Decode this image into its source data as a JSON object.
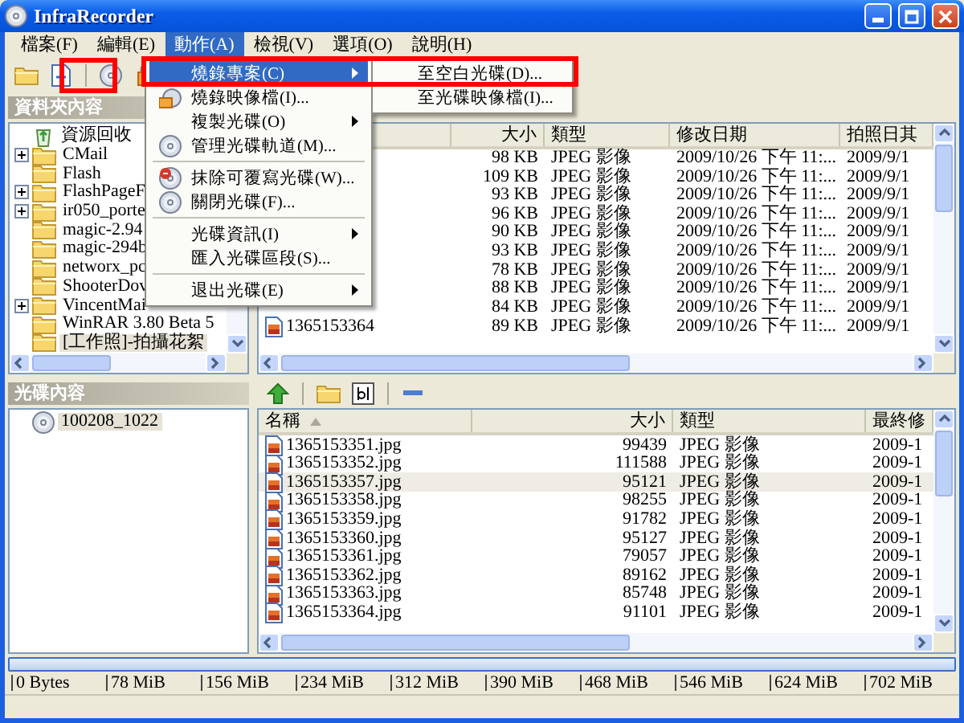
{
  "window": {
    "title": "InfraRecorder"
  },
  "menu_bar": [
    {
      "label": "檔案(F)",
      "selected": false
    },
    {
      "label": "編輯(E)",
      "selected": false
    },
    {
      "label": "動作(A)",
      "selected": true
    },
    {
      "label": "檢視(V)",
      "selected": false
    },
    {
      "label": "選項(O)",
      "selected": false
    },
    {
      "label": "說明(H)",
      "selected": false
    }
  ],
  "actions_menu": {
    "items": [
      {
        "kind": "item",
        "label": "燒錄專案(C)",
        "submenu": true,
        "selected": true
      },
      {
        "kind": "item",
        "label": "燒錄映像檔(I)...",
        "submenu": false,
        "selected": false
      },
      {
        "kind": "item",
        "label": "複製光碟(O)",
        "submenu": true,
        "selected": false
      },
      {
        "kind": "item",
        "label": "管理光碟軌道(M)...",
        "submenu": false,
        "selected": false
      },
      {
        "kind": "separator"
      },
      {
        "kind": "item",
        "label": "抹除可覆寫光碟(W)...",
        "submenu": false,
        "selected": false
      },
      {
        "kind": "item",
        "label": "關閉光碟(F)...",
        "submenu": false,
        "selected": false
      },
      {
        "kind": "separator"
      },
      {
        "kind": "item",
        "label": "光碟資訊(I)",
        "submenu": true,
        "selected": false
      },
      {
        "kind": "item",
        "label": "匯入光碟區段(S)...",
        "submenu": false,
        "selected": false
      },
      {
        "kind": "separator"
      },
      {
        "kind": "item",
        "label": "退出光碟(E)",
        "submenu": true,
        "selected": false
      }
    ]
  },
  "burn_project_submenu": {
    "items": [
      {
        "label": "至空白光碟(D)...",
        "selected": false
      },
      {
        "label": "至光碟映像檔(I)...",
        "selected": false
      }
    ]
  },
  "folder_panel": {
    "title": "資料夾內容",
    "tree": [
      {
        "label": "資源回收",
        "has_children": false,
        "selected": false
      },
      {
        "label": "CMail",
        "has_children": true,
        "selected": false
      },
      {
        "label": "Flash",
        "has_children": false,
        "selected": false
      },
      {
        "label": "FlashPageF",
        "has_children": true,
        "selected": false
      },
      {
        "label": "ir050_porte",
        "has_children": true,
        "selected": false
      },
      {
        "label": "magic-2.94",
        "has_children": false,
        "selected": false
      },
      {
        "label": "magic-294b",
        "has_children": false,
        "selected": false
      },
      {
        "label": "networx_pc",
        "has_children": false,
        "selected": false
      },
      {
        "label": "ShooterDov",
        "has_children": false,
        "selected": false
      },
      {
        "label": "VincentMai",
        "has_children": true,
        "selected": false
      },
      {
        "label": "WinRAR 3.80 Beta 5",
        "has_children": false,
        "selected": false
      },
      {
        "label": "[工作照]-拍攝花絮",
        "has_children": false,
        "selected": true
      }
    ]
  },
  "folder_list": {
    "columns": [
      "大小",
      "類型",
      "修改日期",
      "拍照日其"
    ],
    "rows": [
      {
        "cells": [
          "98 KB",
          "JPEG 影像",
          "2009/10/26 下午 11:...",
          "2009/9/1"
        ]
      },
      {
        "cells": [
          "109 KB",
          "JPEG 影像",
          "2009/10/26 下午 11:...",
          "2009/9/1"
        ]
      },
      {
        "cells": [
          "93 KB",
          "JPEG 影像",
          "2009/10/26 下午 11:...",
          "2009/9/1"
        ]
      },
      {
        "cells": [
          "96 KB",
          "JPEG 影像",
          "2009/10/26 下午 11:...",
          "2009/9/1"
        ]
      },
      {
        "cells": [
          "90 KB",
          "JPEG 影像",
          "2009/10/26 下午 11:...",
          "2009/9/1"
        ]
      },
      {
        "cells": [
          "93 KB",
          "JPEG 影像",
          "2009/10/26 下午 11:...",
          "2009/9/1"
        ]
      },
      {
        "cells": [
          "78 KB",
          "JPEG 影像",
          "2009/10/26 下午 11:...",
          "2009/9/1"
        ]
      },
      {
        "cells": [
          "88 KB",
          "JPEG 影像",
          "2009/10/26 下午 11:...",
          "2009/9/1"
        ]
      },
      {
        "cells": [
          "84 KB",
          "JPEG 影像",
          "2009/10/26 下午 11:...",
          "2009/9/1"
        ]
      },
      {
        "name": "1365153364",
        "cells": [
          "89 KB",
          "JPEG 影像",
          "2009/10/26 下午 11:...",
          "2009/9/1"
        ]
      }
    ]
  },
  "disc_panel": {
    "title": "光碟內容",
    "tree": [
      {
        "label": "100208_1022",
        "has_children": false,
        "selected": true
      }
    ]
  },
  "disc_list": {
    "name_column": {
      "label": "名稱",
      "sorted": true
    },
    "columns": [
      "大小",
      "類型",
      "最終修"
    ],
    "rows": [
      {
        "name": "1365153351.jpg",
        "cells": [
          "99439",
          "JPEG 影像",
          "2009-1"
        ],
        "selected": false
      },
      {
        "name": "1365153352.jpg",
        "cells": [
          "111588",
          "JPEG 影像",
          "2009-1"
        ],
        "selected": false
      },
      {
        "name": "1365153357.jpg",
        "cells": [
          "95121",
          "JPEG 影像",
          "2009-1"
        ],
        "selected": true
      },
      {
        "name": "1365153358.jpg",
        "cells": [
          "98255",
          "JPEG 影像",
          "2009-1"
        ],
        "selected": false
      },
      {
        "name": "1365153359.jpg",
        "cells": [
          "91782",
          "JPEG 影像",
          "2009-1"
        ],
        "selected": false
      },
      {
        "name": "1365153360.jpg",
        "cells": [
          "95127",
          "JPEG 影像",
          "2009-1"
        ],
        "selected": false
      },
      {
        "name": "1365153361.jpg",
        "cells": [
          "79057",
          "JPEG 影像",
          "2009-1"
        ],
        "selected": false
      },
      {
        "name": "1365153362.jpg",
        "cells": [
          "89162",
          "JPEG 影像",
          "2009-1"
        ],
        "selected": false
      },
      {
        "name": "1365153363.jpg",
        "cells": [
          "85748",
          "JPEG 影像",
          "2009-1"
        ],
        "selected": false
      },
      {
        "name": "1365153364.jpg",
        "cells": [
          "91101",
          "JPEG 影像",
          "2009-1"
        ],
        "selected": false
      }
    ]
  },
  "capacity_scale": {
    "ticks": [
      "0 Bytes",
      "78 MiB",
      "156 MiB",
      "234 MiB",
      "312 MiB",
      "390 MiB",
      "468 MiB",
      "546 MiB",
      "624 MiB",
      "702 MiB"
    ]
  },
  "callouts": [
    {
      "kind": "frame"
    },
    {
      "kind": "frame"
    }
  ]
}
